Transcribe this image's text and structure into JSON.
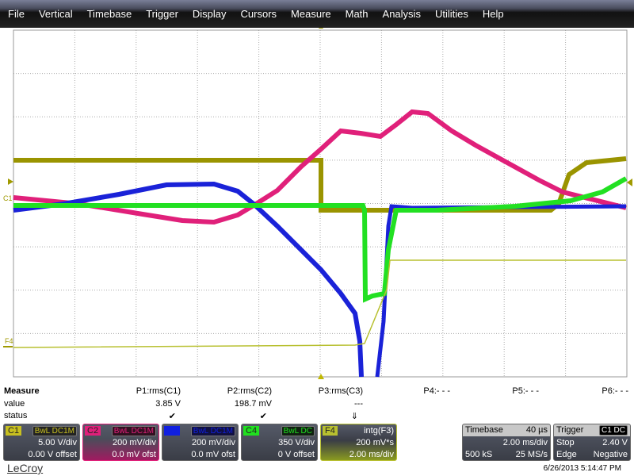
{
  "menu": [
    "File",
    "Vertical",
    "Timebase",
    "Trigger",
    "Display",
    "Cursors",
    "Measure",
    "Math",
    "Analysis",
    "Utilities",
    "Help"
  ],
  "markers": {
    "c_left": "C1",
    "f4_left": "F4"
  },
  "measure": {
    "title": "Measure",
    "row_value": "value",
    "row_status": "status",
    "params": [
      {
        "name": "P1:rms(C1)",
        "value": "3.85 V",
        "status": "✔"
      },
      {
        "name": "P2:rms(C2)",
        "value": "198.7 mV",
        "status": "✔"
      },
      {
        "name": "P3:rms(C3)",
        "value": "---",
        "status": "⇓"
      },
      {
        "name": "P4:- - -",
        "value": "",
        "status": ""
      },
      {
        "name": "P5:- - -",
        "value": "",
        "status": ""
      },
      {
        "name": "P6:- - -",
        "value": "",
        "status": ""
      }
    ]
  },
  "channels": [
    {
      "id": "C1",
      "bw": "BwL",
      "coupling": "DC1M",
      "scale": "5.00 V/div",
      "offset": "0.00 V offset",
      "color": "#c8c020"
    },
    {
      "id": "C2",
      "bw": "BwL",
      "coupling": "DC1M",
      "scale": "200 mV/div",
      "offset": "0.0 mV ofst",
      "color": "#e0207a"
    },
    {
      "id": "C3",
      "bw": "BwL",
      "coupling": "DC1M",
      "scale": "200 mV/div",
      "offset": "0.0 mV ofst",
      "color": "#1020e0"
    },
    {
      "id": "C4",
      "bw": "BwL",
      "coupling": "DC",
      "scale": "350 V/div",
      "offset": "0 V offset",
      "color": "#20e020"
    }
  ],
  "math": {
    "id": "F4",
    "func": "intg(F3)",
    "scale": "200 mV*s",
    "time": "2.00 ms/div",
    "color": "#b8c030"
  },
  "timebase": {
    "label": "Timebase",
    "delay": "40 µs",
    "scale": "2.00 ms/div",
    "samples": "500 kS",
    "rate": "25 MS/s"
  },
  "trigger": {
    "label": "Trigger",
    "source": "C1",
    "coupling": "DC",
    "mode": "Stop",
    "level": "2.40 V",
    "type": "Edge",
    "slope": "Negative"
  },
  "brand": "LeCroy",
  "timestamp": "6/26/2013 5:14:47 PM"
}
